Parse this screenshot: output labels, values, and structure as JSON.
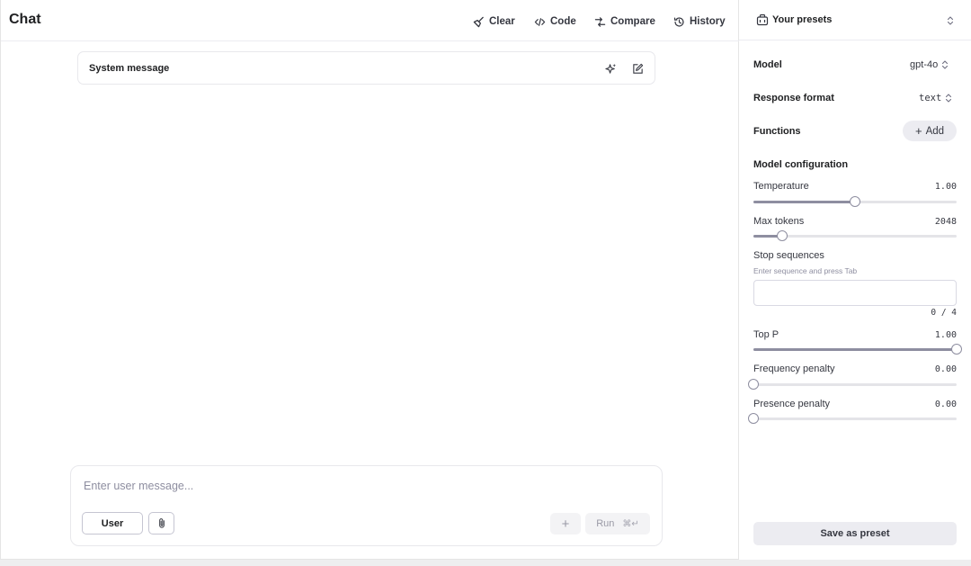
{
  "header": {
    "title": "Chat",
    "clear_label": "Clear",
    "code_label": "Code",
    "compare_label": "Compare",
    "history_label": "History"
  },
  "system_message": {
    "label": "System message"
  },
  "composer": {
    "placeholder": "Enter user message...",
    "role_label": "User",
    "run_label": "Run",
    "run_shortcut": "⌘↵"
  },
  "sidebar": {
    "presets_label": "Your presets",
    "model_label": "Model",
    "model_value": "gpt-4o",
    "response_format_label": "Response format",
    "response_format_value": "text",
    "functions_label": "Functions",
    "add_label": "Add",
    "model_config_label": "Model configuration",
    "params": [
      {
        "label": "Temperature",
        "value": "1.00",
        "fraction": 0.5
      },
      {
        "label": "Max tokens",
        "value": "2048",
        "fraction": 0.143
      },
      {
        "label": "Top P",
        "value": "1.00",
        "fraction": 1.0
      },
      {
        "label": "Frequency penalty",
        "value": "0.00",
        "fraction": 0.0
      },
      {
        "label": "Presence penalty",
        "value": "0.00",
        "fraction": 0.0
      }
    ],
    "stop_sequences": {
      "label": "Stop sequences",
      "hint": "Enter sequence and press Tab",
      "count": "0 / 4"
    },
    "save_label": "Save as preset"
  },
  "colors": {
    "text": "#202123",
    "border": "#e5e5e5",
    "muted": "#8e8ea0",
    "button_bg": "#ececf1"
  }
}
